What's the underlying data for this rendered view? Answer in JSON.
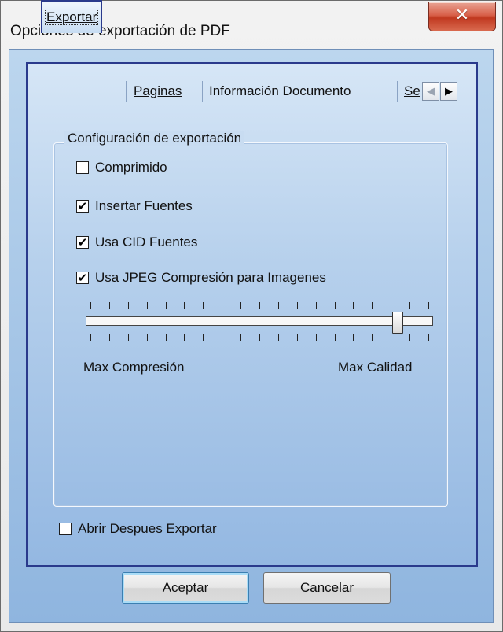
{
  "window": {
    "title": "Opciones de exportación de PDF",
    "close_glyph": "✕"
  },
  "tabs": [
    {
      "label": "Exportar",
      "active": true
    },
    {
      "label": "Paginas",
      "active": false
    },
    {
      "label": "Información Documento",
      "active": false
    },
    {
      "label": "Se",
      "active": false
    }
  ],
  "tab_scroll": {
    "left_icon": "◀",
    "right_icon": "▶"
  },
  "export_group": {
    "title": "Configuración de exportación",
    "options": [
      {
        "label": "Comprimido",
        "checked": false
      },
      {
        "label": "Insertar Fuentes",
        "checked": true
      },
      {
        "label": "Usa CID Fuentes",
        "checked": true
      },
      {
        "label": "Usa JPEG Compresión para Imagenes",
        "checked": true
      }
    ],
    "quality_slider": {
      "min_label": "Max Compresión",
      "max_label": "Max Calidad",
      "value_fraction": 0.9
    }
  },
  "open_after_export": {
    "label": "Abrir Despues Exportar",
    "checked": false
  },
  "buttons": {
    "accept": "Aceptar",
    "cancel": "Cancelar"
  },
  "colors": {
    "close_button": "#c8452c",
    "panel_border": "#2a3a8c",
    "default_button_border": "#3c7fb1"
  }
}
